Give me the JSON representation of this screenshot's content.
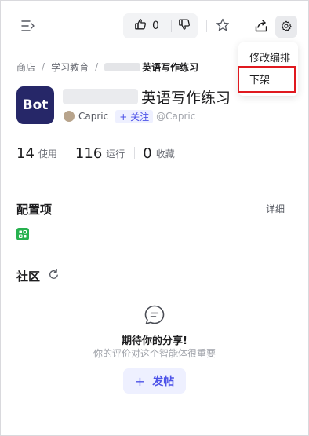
{
  "toolbar": {
    "like_count": "0"
  },
  "menu": {
    "edit_label": "修改编排",
    "unpublish_label": "下架"
  },
  "breadcrumb": {
    "store": "商店",
    "sep": "/",
    "category": "学习教育",
    "current": "英语写作练习"
  },
  "bot": {
    "avatar_text": "Bot",
    "title": "英语写作练习",
    "creator_name": "Capric",
    "follow_label": "+ 关注",
    "handle": "@Capric"
  },
  "stats": {
    "uses_value": "14",
    "uses_label": "使用",
    "runs_value": "116",
    "runs_label": "运行",
    "favorites_value": "0",
    "favorites_label": "收藏"
  },
  "config": {
    "title": "配置项",
    "details_label": "详细"
  },
  "community": {
    "title": "社区",
    "empty_title": "期待你的分享!",
    "empty_subtitle": "你的评价对这个智能体很重要",
    "post_icon": "+",
    "post_label": "发帖"
  },
  "colors": {
    "accent": "#4d53e8",
    "avatar_bg": "#262768",
    "highlight": "#e0191f",
    "plugin_green": "#27b14f"
  },
  "icons": [
    "collapse-sidebar-icon",
    "thumbs-up-icon",
    "thumbs-down-icon",
    "star-icon",
    "share-icon",
    "gear-icon",
    "refresh-icon",
    "comment-icon",
    "plugin-icon"
  ]
}
